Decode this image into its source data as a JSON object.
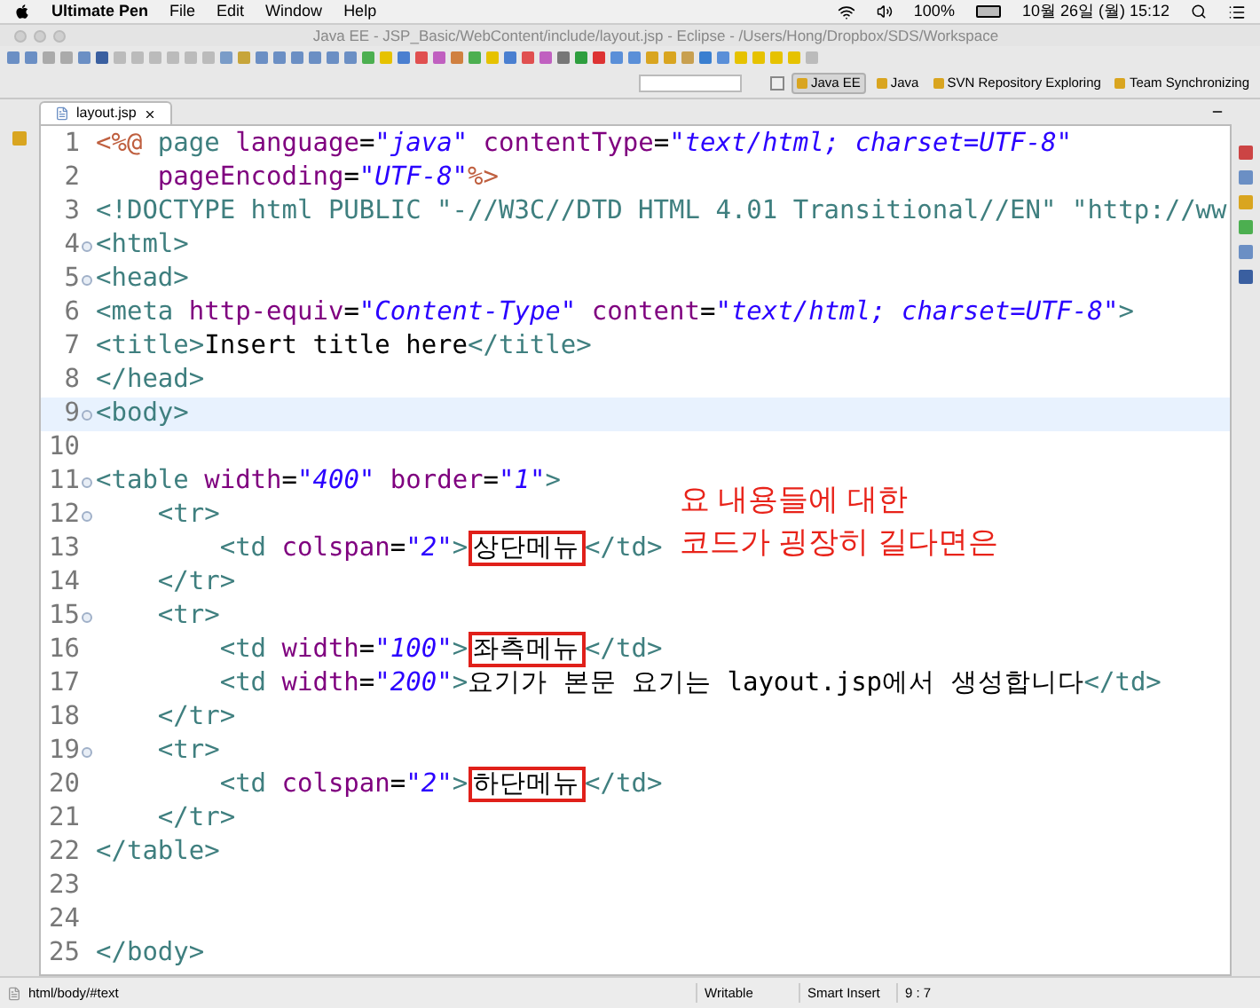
{
  "menubar": {
    "app": "Ultimate Pen",
    "items": [
      "File",
      "Edit",
      "Window",
      "Help"
    ],
    "battery": "100%",
    "clock": "10월 26일 (월) 15:12"
  },
  "window": {
    "title": "Java EE - JSP_Basic/WebContent/include/layout.jsp - Eclipse - /Users/Hong/Dropbox/SDS/Workspace"
  },
  "perspectives": [
    {
      "label": "Java EE",
      "selected": true
    },
    {
      "label": "Java",
      "selected": false
    },
    {
      "label": "SVN Repository Exploring",
      "selected": false
    },
    {
      "label": "Team Synchronizing",
      "selected": false
    }
  ],
  "editor_tab": {
    "label": "layout.jsp"
  },
  "lines": [
    {
      "number": "1",
      "current": false,
      "fold": false,
      "tokens": [
        {
          "kind": "jsp",
          "text": "<%@"
        },
        {
          "kind": "tag",
          "text": " page"
        },
        {
          "kind": "attr",
          "text": " language"
        },
        {
          "kind": "plain",
          "text": "="
        },
        {
          "kind": "value",
          "text": "\"java\""
        },
        {
          "kind": "attr",
          "text": " contentType"
        },
        {
          "kind": "plain",
          "text": "="
        },
        {
          "kind": "value",
          "text": "\"text/html; charset=UTF-8\""
        }
      ]
    },
    {
      "number": "2",
      "current": false,
      "fold": false,
      "tokens": [
        {
          "kind": "attr",
          "text": "    pageEncoding"
        },
        {
          "kind": "plain",
          "text": "="
        },
        {
          "kind": "value",
          "text": "\"UTF-8\""
        },
        {
          "kind": "jsp",
          "text": "%>"
        }
      ]
    },
    {
      "number": "3",
      "current": false,
      "fold": false,
      "tokens": [
        {
          "kind": "tag",
          "text": "<!DOCTYPE html PUBLIC \"-//W3C//DTD HTML 4.01 Transitional//EN\" \"http://ww"
        }
      ]
    },
    {
      "number": "4",
      "current": false,
      "fold": true,
      "tokens": [
        {
          "kind": "tag",
          "text": "<html>"
        }
      ]
    },
    {
      "number": "5",
      "current": false,
      "fold": true,
      "tokens": [
        {
          "kind": "tag",
          "text": "<head>"
        }
      ]
    },
    {
      "number": "6",
      "current": false,
      "fold": false,
      "tokens": [
        {
          "kind": "tag",
          "text": "<meta"
        },
        {
          "kind": "attr",
          "text": " http-equiv"
        },
        {
          "kind": "plain",
          "text": "="
        },
        {
          "kind": "value",
          "text": "\"Content-Type\""
        },
        {
          "kind": "attr",
          "text": " content"
        },
        {
          "kind": "plain",
          "text": "="
        },
        {
          "kind": "value",
          "text": "\"text/html; charset=UTF-8\""
        },
        {
          "kind": "tag",
          "text": ">"
        }
      ]
    },
    {
      "number": "7",
      "current": false,
      "fold": false,
      "tokens": [
        {
          "kind": "tag",
          "text": "<title>"
        },
        {
          "kind": "plain",
          "text": "Insert title here"
        },
        {
          "kind": "tag",
          "text": "</title>"
        }
      ]
    },
    {
      "number": "8",
      "current": false,
      "fold": false,
      "tokens": [
        {
          "kind": "tag",
          "text": "</head>"
        }
      ]
    },
    {
      "number": "9",
      "current": true,
      "fold": true,
      "tokens": [
        {
          "kind": "tag",
          "text": "<body>"
        }
      ]
    },
    {
      "number": "10",
      "current": false,
      "fold": false
    },
    {
      "number": "11",
      "current": false,
      "fold": true,
      "tokens": [
        {
          "kind": "tag",
          "text": "<table"
        },
        {
          "kind": "attr",
          "text": " width"
        },
        {
          "kind": "plain",
          "text": "="
        },
        {
          "kind": "value",
          "text": "\"400\""
        },
        {
          "kind": "attr",
          "text": " border"
        },
        {
          "kind": "plain",
          "text": "="
        },
        {
          "kind": "value",
          "text": "\"1\""
        },
        {
          "kind": "tag",
          "text": ">"
        }
      ]
    },
    {
      "number": "12",
      "current": false,
      "fold": true,
      "tokens": [
        {
          "kind": "tag",
          "text": "    <tr>"
        }
      ]
    },
    {
      "number": "13",
      "current": false,
      "fold": false,
      "tokens": [
        {
          "kind": "tag",
          "text": "        <td"
        },
        {
          "kind": "attr",
          "text": " colspan"
        },
        {
          "kind": "plain",
          "text": "="
        },
        {
          "kind": "value",
          "text": "\"2\""
        },
        {
          "kind": "tag",
          "text": ">"
        },
        {
          "kind": "plain",
          "text": "상단메뉴",
          "boxed": true
        },
        {
          "kind": "tag",
          "text": "</td>"
        }
      ]
    },
    {
      "number": "14",
      "current": false,
      "fold": false,
      "tokens": [
        {
          "kind": "tag",
          "text": "    </tr>"
        }
      ]
    },
    {
      "number": "15",
      "current": false,
      "fold": true,
      "tokens": [
        {
          "kind": "tag",
          "text": "    <tr>"
        }
      ]
    },
    {
      "number": "16",
      "current": false,
      "fold": false,
      "tokens": [
        {
          "kind": "tag",
          "text": "        <td"
        },
        {
          "kind": "attr",
          "text": " width"
        },
        {
          "kind": "plain",
          "text": "="
        },
        {
          "kind": "value",
          "text": "\"100\""
        },
        {
          "kind": "tag",
          "text": ">"
        },
        {
          "kind": "plain",
          "text": "좌측메뉴",
          "boxed": true
        },
        {
          "kind": "tag",
          "text": "</td>"
        }
      ]
    },
    {
      "number": "17",
      "current": false,
      "fold": false,
      "tokens": [
        {
          "kind": "tag",
          "text": "        <td"
        },
        {
          "kind": "attr",
          "text": " width"
        },
        {
          "kind": "plain",
          "text": "="
        },
        {
          "kind": "value",
          "text": "\"200\""
        },
        {
          "kind": "tag",
          "text": ">"
        },
        {
          "kind": "plain",
          "text": "요기가 본문 요기는 layout.jsp에서 생성합니다"
        },
        {
          "kind": "tag",
          "text": "</td>"
        }
      ]
    },
    {
      "number": "18",
      "current": false,
      "fold": false,
      "tokens": [
        {
          "kind": "tag",
          "text": "    </tr>"
        }
      ]
    },
    {
      "number": "19",
      "current": false,
      "fold": true,
      "tokens": [
        {
          "kind": "tag",
          "text": "    <tr>"
        }
      ]
    },
    {
      "number": "20",
      "current": false,
      "fold": false,
      "tokens": [
        {
          "kind": "tag",
          "text": "        <td"
        },
        {
          "kind": "attr",
          "text": " colspan"
        },
        {
          "kind": "plain",
          "text": "="
        },
        {
          "kind": "value",
          "text": "\"2\""
        },
        {
          "kind": "tag",
          "text": ">"
        },
        {
          "kind": "plain",
          "text": "하단메뉴",
          "boxed": true
        },
        {
          "kind": "tag",
          "text": "</td>"
        }
      ]
    },
    {
      "number": "21",
      "current": false,
      "fold": false,
      "tokens": [
        {
          "kind": "tag",
          "text": "    </tr>"
        }
      ]
    },
    {
      "number": "22",
      "current": false,
      "fold": false,
      "tokens": [
        {
          "kind": "tag",
          "text": "</table>"
        }
      ]
    },
    {
      "number": "23",
      "current": false,
      "fold": false
    },
    {
      "number": "24",
      "current": false,
      "fold": false
    },
    {
      "number": "25",
      "current": false,
      "fold": false,
      "tokens": [
        {
          "kind": "tag",
          "text": "</body>"
        }
      ]
    }
  ],
  "annotation": {
    "lines": [
      "요 내용들에 대한",
      "코드가 굉장히 길다면은"
    ]
  },
  "status_bar": {
    "path": "html/body/#text",
    "mode": "Writable",
    "insert": "Smart Insert",
    "position": "9 : 7"
  }
}
